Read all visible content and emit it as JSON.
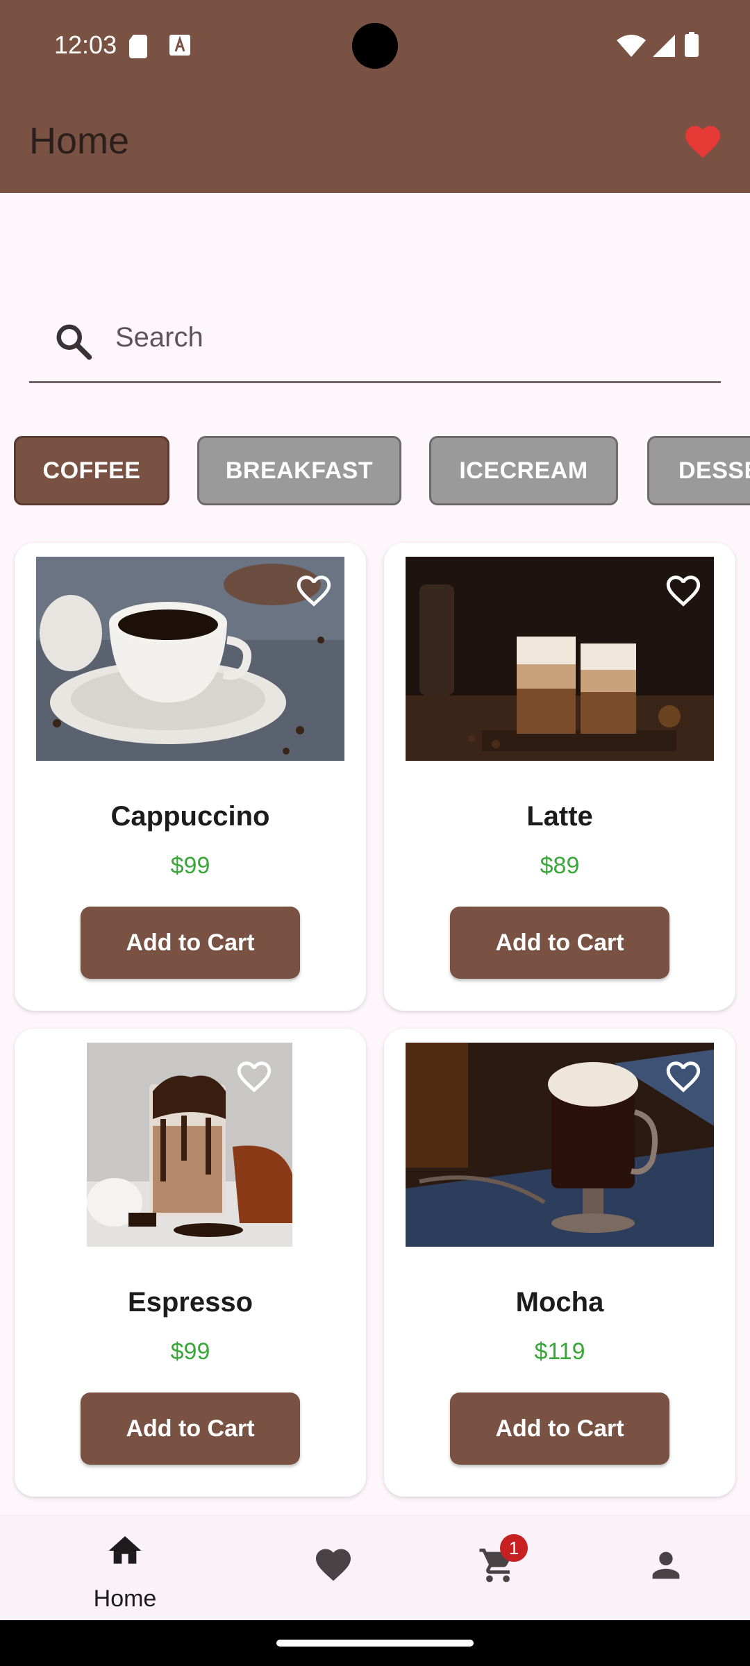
{
  "status_bar": {
    "time": "12:03"
  },
  "app_bar": {
    "title": "Home"
  },
  "search": {
    "placeholder": "Search",
    "value": ""
  },
  "categories": [
    {
      "label": "COFFEE",
      "active": true
    },
    {
      "label": "BREAKFAST",
      "active": false
    },
    {
      "label": "ICECREAM",
      "active": false
    },
    {
      "label": "DESSE",
      "active": false
    }
  ],
  "products": [
    {
      "name": "Cappuccino",
      "price": "$99",
      "button": "Add to Cart"
    },
    {
      "name": "Latte",
      "price": "$89",
      "button": "Add to Cart"
    },
    {
      "name": "Espresso",
      "price": "$99",
      "button": "Add to Cart"
    },
    {
      "name": "Mocha",
      "price": "$119",
      "button": "Add to Cart"
    }
  ],
  "bottom_nav": {
    "home_label": "Home",
    "cart_badge": "1"
  },
  "colors": {
    "brand": "#7a5244",
    "price_green": "#3aa73a",
    "heart_red": "#e53935",
    "inactive_chip": "#9a9a9a"
  }
}
